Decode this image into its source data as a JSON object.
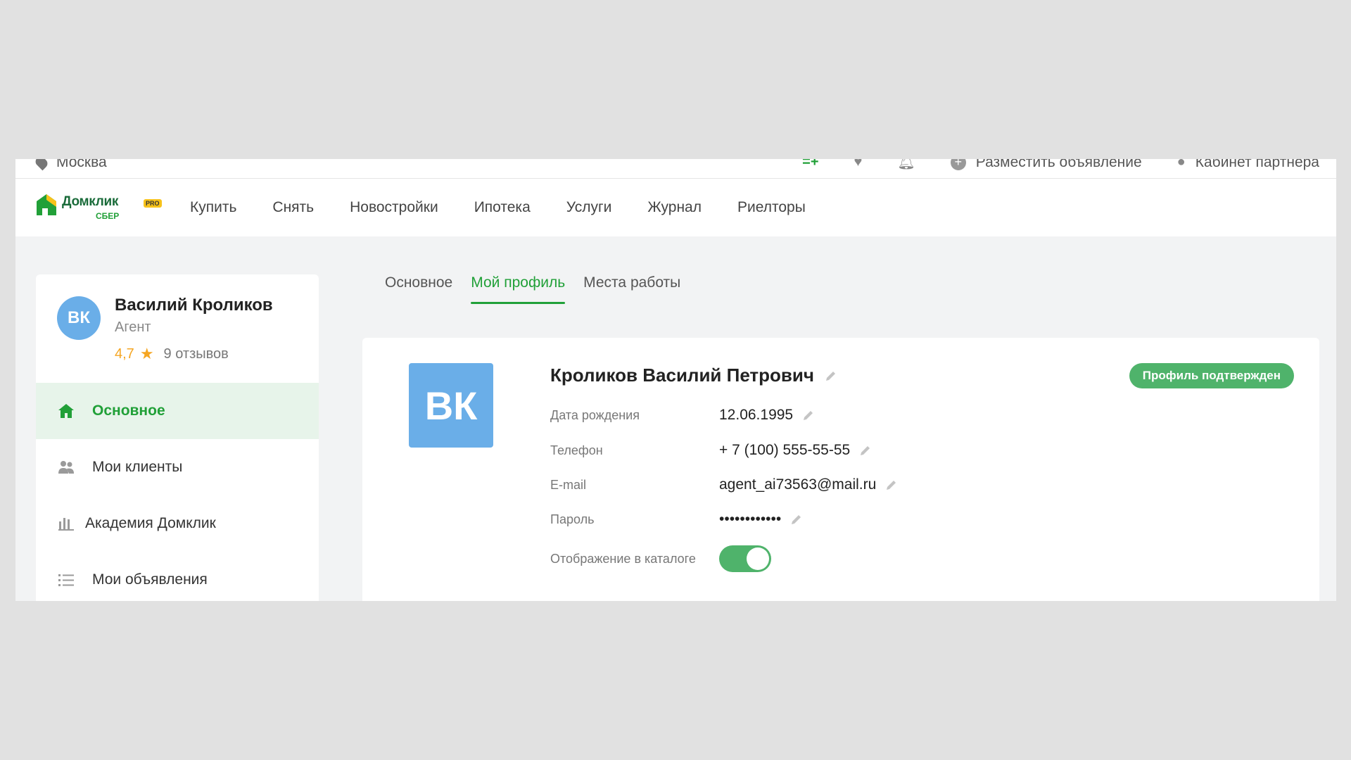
{
  "topbar": {
    "city": "Москва",
    "post_ad": "Разместить объявление",
    "partner_cabinet": "Кабинет партнера"
  },
  "logo": {
    "brand": "Домклик",
    "pro": "PRO",
    "sber": "СБЕР"
  },
  "nav": {
    "items": [
      "Купить",
      "Снять",
      "Новостройки",
      "Ипотека",
      "Услуги",
      "Журнал",
      "Риелторы"
    ]
  },
  "user": {
    "initials": "ВК",
    "name": "Василий Кроликов",
    "role": "Агент",
    "rating": "4,7",
    "reviews": "9 отзывов"
  },
  "sidebar": {
    "items": [
      {
        "label": "Основное",
        "icon": "home-icon",
        "active": true
      },
      {
        "label": "Мои клиенты",
        "icon": "clients-icon",
        "active": false
      },
      {
        "label": "Академия Домклик",
        "icon": "academy-icon",
        "active": false
      },
      {
        "label": "Мои объявления",
        "icon": "list-icon",
        "active": false
      }
    ]
  },
  "tabs": [
    {
      "label": "Основное",
      "active": false
    },
    {
      "label": "Мой профиль",
      "active": true
    },
    {
      "label": "Места работы",
      "active": false
    }
  ],
  "profile": {
    "initials": "ВК",
    "full_name": "Кроликов Василий Петрович",
    "verified_badge": "Профиль подтвержден",
    "fields": {
      "birth_label": "Дата рождения",
      "birth_value": "12.06.1995",
      "phone_label": "Телефон",
      "phone_value": "+ 7 (100) 555-55-55",
      "email_label": "E-mail",
      "email_value": "agent_ai73563@mail.ru",
      "password_label": "Пароль",
      "password_value": "••••••••••••",
      "catalog_label": "Отображение в каталоге",
      "catalog_enabled": true
    }
  },
  "colors": {
    "accent": "#21a038",
    "badge": "#4fb36b",
    "avatar": "#6aaee8",
    "rating": "#f5a623"
  }
}
